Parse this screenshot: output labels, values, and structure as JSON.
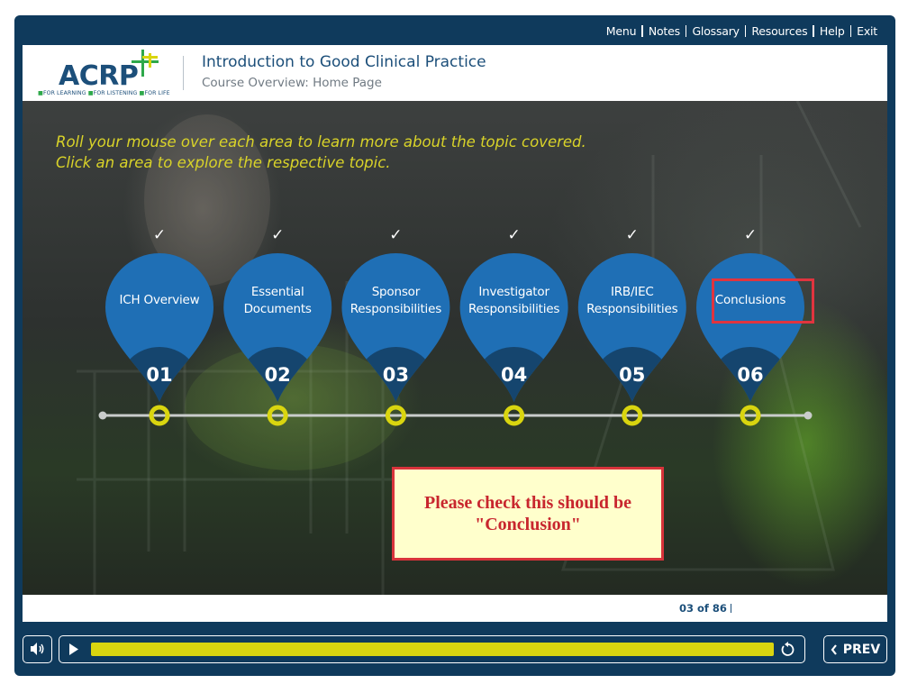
{
  "topnav": {
    "items": [
      "Menu",
      "Notes",
      "Glossary",
      "Resources",
      "Help",
      "Exit"
    ]
  },
  "header": {
    "logo": {
      "text": "ACRP",
      "tagline_parts": [
        "FOR LEARNING",
        "FOR LISTENING",
        "FOR LIFE"
      ]
    },
    "title": "Introduction to Good Clinical Practice",
    "subtitle": "Course Overview: Home Page"
  },
  "instructions": [
    "Roll your mouse over each area to learn more about the topic covered.",
    "Click an area to explore the respective topic."
  ],
  "topics": [
    {
      "label_lines": [
        "ICH Overview"
      ],
      "number": "01",
      "completed": true
    },
    {
      "label_lines": [
        "Essential",
        "Documents"
      ],
      "number": "02",
      "completed": true
    },
    {
      "label_lines": [
        "Sponsor",
        "Responsibilities"
      ],
      "number": "03",
      "completed": true
    },
    {
      "label_lines": [
        "Investigator",
        "Responsibilities"
      ],
      "number": "04",
      "completed": true
    },
    {
      "label_lines": [
        "IRB/IEC",
        "Responsibilities"
      ],
      "number": "05",
      "completed": true
    },
    {
      "label_lines": [
        "Conclusions"
      ],
      "number": "06",
      "completed": true
    }
  ],
  "check_glyph": "✓",
  "review_comment": {
    "line1": "Please check this should be",
    "line2": "\"Conclusion\""
  },
  "footer": {
    "slide_counter": "03 of 86"
  },
  "controls": {
    "progress_fraction": 1.0,
    "prev_label": "PREV",
    "volume_icon": "speaker-icon",
    "play_icon": "play-icon",
    "replay_icon": "replay-icon"
  },
  "colors": {
    "frame": "#0f3a5c",
    "pin_blue": "#1f6fb5",
    "pin_dark": "#15456e",
    "accent_yellow": "#d9d50f",
    "instruction_yellow": "#d9d329",
    "review_red": "#d8333b",
    "review_bg": "#ffffcc"
  }
}
